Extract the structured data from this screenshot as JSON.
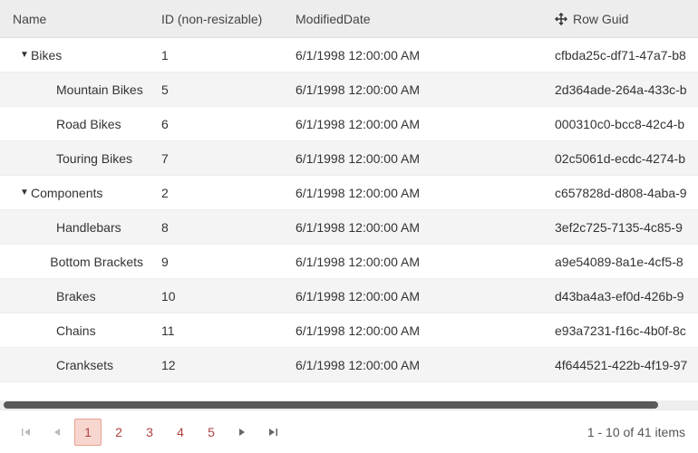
{
  "columns": {
    "name": "Name",
    "id": "ID (non-resizable)",
    "modified": "ModifiedDate",
    "guid": "Row Guid"
  },
  "rows": [
    {
      "level": 0,
      "expandable": true,
      "name": "Bikes",
      "id": "1",
      "date": "6/1/1998 12:00:00 AM",
      "guid": "cfbda25c-df71-47a7-b8"
    },
    {
      "level": 1,
      "expandable": false,
      "name": "Mountain Bikes",
      "id": "5",
      "date": "6/1/1998 12:00:00 AM",
      "guid": "2d364ade-264a-433c-b"
    },
    {
      "level": 1,
      "expandable": false,
      "name": "Road Bikes",
      "id": "6",
      "date": "6/1/1998 12:00:00 AM",
      "guid": "000310c0-bcc8-42c4-b"
    },
    {
      "level": 1,
      "expandable": false,
      "name": "Touring Bikes",
      "id": "7",
      "date": "6/1/1998 12:00:00 AM",
      "guid": "02c5061d-ecdc-4274-b"
    },
    {
      "level": 0,
      "expandable": true,
      "name": "Components",
      "id": "2",
      "date": "6/1/1998 12:00:00 AM",
      "guid": "c657828d-d808-4aba-9"
    },
    {
      "level": 1,
      "expandable": false,
      "name": "Handlebars",
      "id": "8",
      "date": "6/1/1998 12:00:00 AM",
      "guid": "3ef2c725-7135-4c85-9"
    },
    {
      "level": 1,
      "expandable": false,
      "name": "Bottom Brackets",
      "id": "9",
      "date": "6/1/1998 12:00:00 AM",
      "guid": "a9e54089-8a1e-4cf5-8"
    },
    {
      "level": 1,
      "expandable": false,
      "name": "Brakes",
      "id": "10",
      "date": "6/1/1998 12:00:00 AM",
      "guid": "d43ba4a3-ef0d-426b-9"
    },
    {
      "level": 1,
      "expandable": false,
      "name": "Chains",
      "id": "11",
      "date": "6/1/1998 12:00:00 AM",
      "guid": "e93a7231-f16c-4b0f-8c"
    },
    {
      "level": 1,
      "expandable": false,
      "name": "Cranksets",
      "id": "12",
      "date": "6/1/1998 12:00:00 AM",
      "guid": "4f644521-422b-4f19-97"
    }
  ],
  "pager": {
    "pages": [
      "1",
      "2",
      "3",
      "4",
      "5"
    ],
    "active": "1",
    "info": "1 - 10 of 41 items"
  }
}
